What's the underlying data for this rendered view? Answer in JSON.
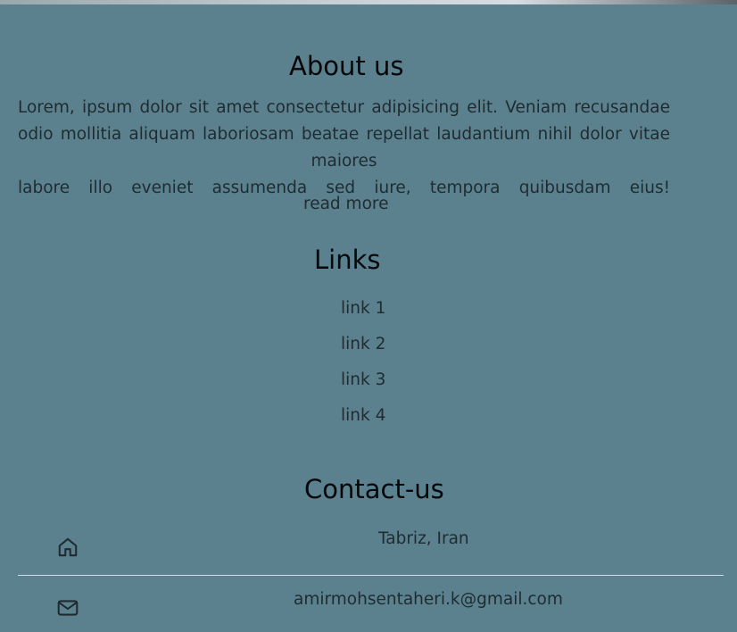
{
  "about": {
    "title": "About us",
    "text": "Lorem, ipsum dolor sit amet consectetur adipisicing elit. Veniam recusandae odio mollitia aliquam laboriosam beatae repellat laudantium nihil dolor vitae maiores",
    "text_last_line": "labore illo eveniet assumenda sed iure, tempora quibusdam eius!",
    "read_more_label": "read more"
  },
  "links": {
    "title": "Links",
    "items": [
      {
        "label": "link 1"
      },
      {
        "label": "link 2"
      },
      {
        "label": "link 3"
      },
      {
        "label": "link 4"
      }
    ]
  },
  "contact": {
    "title": "Contact-us",
    "address": {
      "icon": "home-icon",
      "value": "Tabriz, Iran"
    },
    "email": {
      "icon": "mail-icon",
      "value": "amirmohsentaheri.k@gmail.com"
    }
  },
  "colors": {
    "background": "#5b818f",
    "text": "#1f2b30",
    "heading": "#050708",
    "divider": "#d0dde2"
  }
}
